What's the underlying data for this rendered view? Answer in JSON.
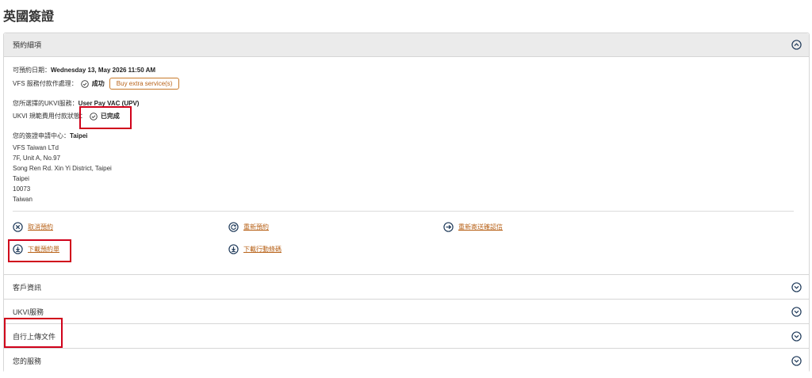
{
  "page": {
    "title": "英國簽證"
  },
  "booking": {
    "header": "預約細項",
    "date_label": "可預約日期：",
    "date_value": "Wednesday 13, May 2026 11:50 AM",
    "vfs_pay_label": "VFS 服務付款作處理：",
    "vfs_pay_status": "成功",
    "extra_service_button": "Buy extra service(s)",
    "ukvi_service_label": "您所選擇的UKVI服務：",
    "ukvi_service_value": "User Pay VAC (UPV)",
    "ukvi_fee_label": "UKVI 規範費用付款狀態：",
    "ukvi_fee_status": "已完成",
    "centre_label": "您的簽證申請中心：",
    "centre_value": "Taipei",
    "address": [
      "VFS Taiwan LTd",
      "7F, Unit A, No.97",
      "Song Ren Rd. Xin Yi District, Taipei",
      "Taipei",
      "10073",
      "Taiwan"
    ],
    "actions": {
      "cancel": "取消預約",
      "reschedule": "重新預約",
      "resend": "重新寄送確認信",
      "download_booking": "下載預約單",
      "download_barcode": "下載行動條碼"
    }
  },
  "sections": [
    {
      "label": "客戶資訊"
    },
    {
      "label": "UKVI服務"
    },
    {
      "label": "自行上傳文件"
    },
    {
      "label": "您的服務"
    }
  ],
  "colors": {
    "accent": "#b8631a",
    "highlight": "#d0021b",
    "icon": "#1f3a5a"
  }
}
